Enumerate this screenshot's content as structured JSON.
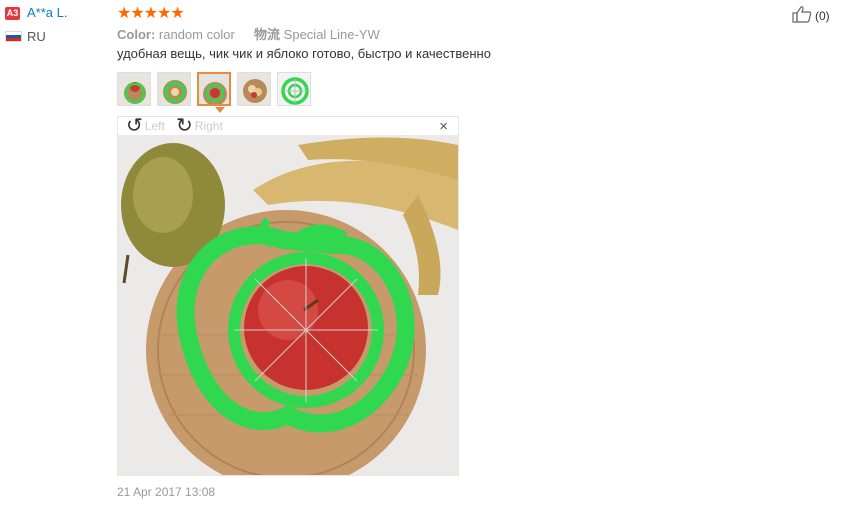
{
  "reviewer": {
    "badge": "A3",
    "name": "A**a L.",
    "country": "RU",
    "flag_colors": [
      "#ffffff",
      "#2255aa",
      "#d52b1e"
    ]
  },
  "review": {
    "stars": "★★★★★",
    "rating": 5,
    "star_color": "#ff6a00",
    "color_label": "Color:",
    "color_value": "random color",
    "shipping_label": "物流",
    "shipping_value": "Special Line-YW",
    "text": "удобная вещь, чик чик и яблоко готово, быстро и качественно",
    "date": "21 Apr 2017 13:08"
  },
  "thumbnails": {
    "count": 5,
    "active_index": 2
  },
  "viewer": {
    "rotate_left_label": "Left",
    "rotate_right_label": "Right",
    "rotate_left_icon": "↺",
    "rotate_right_icon": "↻",
    "close_icon": "×"
  },
  "helpful": {
    "count_text": "(0)"
  },
  "colors": {
    "link": "#0d7cc1",
    "badge": "#e4393c",
    "active_thumb": "#e88b3a",
    "slicer_green": "#2fd84e"
  }
}
